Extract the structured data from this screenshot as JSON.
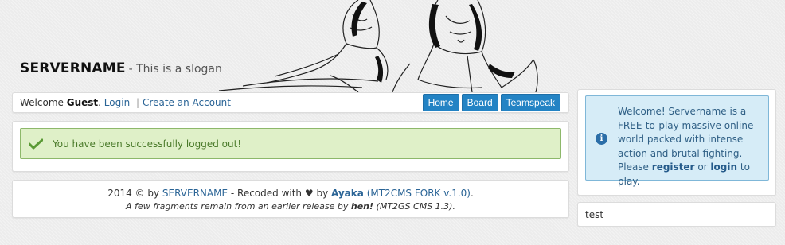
{
  "header": {
    "site_name": "SERVERNAME",
    "slogan": "- This is a slogan"
  },
  "navbar": {
    "welcome_prefix": "Welcome",
    "user": "Guest",
    "period": ".",
    "login_link": "Login",
    "separator": "|",
    "register_link": "Create an Account",
    "buttons": [
      "Home",
      "Board",
      "Teamspeak"
    ]
  },
  "message": {
    "text": "You have been successfully logged out!"
  },
  "footer": {
    "year_copy": "2014 © by",
    "site_link": "SERVERNAME",
    "recoded": "- Recoded with",
    "heart": "♥",
    "by": "by",
    "author": "Ayaka",
    "fork": "(MT2CMS FORK v.1.0)",
    "period": ".",
    "line2_prefix": "A few fragments remain from an earlier release by",
    "line2_author": "hen!",
    "line2_suffix": "(MT2GS CMS 1.3)."
  },
  "sidebar": {
    "info_text_before": "Welcome! Servername is a FREE-to-play massive online world packed with intense action and brutal fighting. Please",
    "register_link": "register",
    "or": "or",
    "login_link": "login",
    "info_text_after": "to play.",
    "test_box": "test"
  },
  "colors": {
    "accent": "#2383c4",
    "success_bg": "#dff0c8",
    "success_text": "#4a7a2a",
    "info_bg": "#d6ecf7",
    "link": "#2a6496"
  },
  "icons": {
    "success": "check-icon",
    "info": "info-icon"
  }
}
